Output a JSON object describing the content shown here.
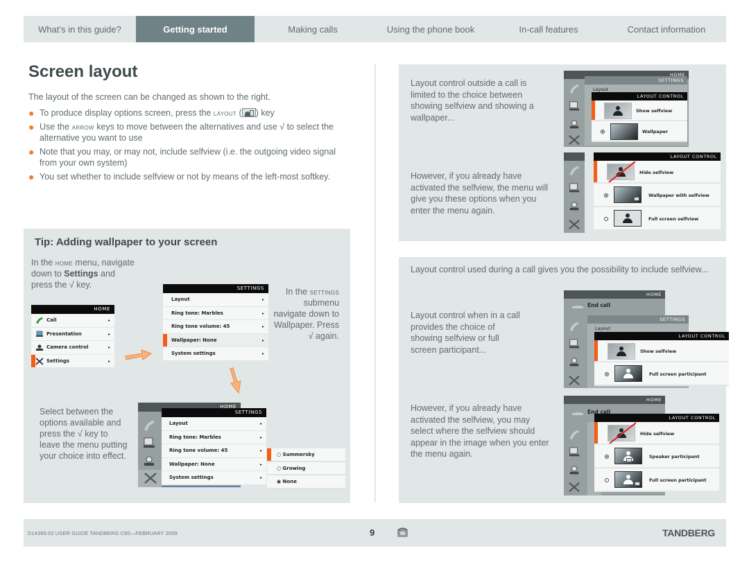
{
  "nav": {
    "tabs": [
      {
        "label": "What’s in this guide?",
        "active": false
      },
      {
        "label": "Getting started",
        "active": true
      },
      {
        "label": "Making calls",
        "active": false
      },
      {
        "label": "Using the phone book",
        "active": false
      },
      {
        "label": "In-call features",
        "active": false
      },
      {
        "label": "Contact information",
        "active": false
      }
    ]
  },
  "page": {
    "title": "Screen layout",
    "intro": "The layout of the screen can be changed as shown to the right.",
    "bullets": {
      "b1_pre": "To produce display options screen, press the ",
      "b1_key": "layout",
      "b1_post": ") key",
      "b2_pre": "Use the ",
      "b2_key": "arrow",
      "b2_post": " keys to move between the alternatives and use √ to select the alternative you want to use",
      "b3": "Note that you may, or may not, include selfview (i.e. the outgoing video signal from your own system)",
      "b4": "You set whether to include selfview or not by means of the left-most softkey."
    },
    "bullet_color": "#f07b2c",
    "key_icon": "layout-key-icon"
  },
  "tip": {
    "title": "Tip: Adding wallpaper to your screen",
    "step1_pre": "In the ",
    "step1_key": "home",
    "step1_mid": " menu, navigate down to ",
    "step1_bold": "Settings",
    "step1_post": " and press the √ key.",
    "step2_pre": "In the ",
    "step2_key": "settings",
    "step2_post": " submenu navigate down to Wallpaper. Press √ again.",
    "step3": "Select between the options available and press the √ key to leave the menu putting your choice into effect.",
    "home_menu": {
      "header": "HOME",
      "items": [
        "Call",
        "Presentation",
        "Camera control",
        "Settings"
      ],
      "selected": "Settings"
    },
    "settings_menu": {
      "header": "SETTINGS",
      "items": [
        "Layout",
        "Ring tone: Marbles",
        "Ring tone volume: 45",
        "Wallpaper: None",
        "System settings"
      ],
      "selected": "Wallpaper: None"
    },
    "wallpaper_menu": {
      "home_header": "HOME",
      "settings_header": "SETTINGS",
      "items": [
        "Layout",
        "Ring tone: Marbles",
        "Ring tone volume: 45",
        "Wallpaper: None",
        "System settings"
      ],
      "options": [
        {
          "label": "Summersky",
          "checked": false
        },
        {
          "label": "Growing",
          "checked": false
        },
        {
          "label": "None",
          "checked": true
        }
      ]
    }
  },
  "right_top": {
    "text1": "Layout control outside a call is limited to the choice between showing selfview and showing a wallpaper...",
    "text2": "However, if you already have activated the selfview, the menu will give you these options when you enter the menu again.",
    "mock1": {
      "home_header": "HOME",
      "settings_header": "SETTINGS",
      "settings_row": "Layout",
      "lc_header": "LAYOUT CONTROL",
      "rows": [
        {
          "label": "Show selfview"
        },
        {
          "label": "Wallpaper",
          "radio": "on"
        }
      ]
    },
    "mock2": {
      "lc_header": "LAYOUT CONTROL",
      "rows": [
        {
          "label": "Hide selfview"
        },
        {
          "label": "Wallpaper with selfview",
          "radio": "on"
        },
        {
          "label": "Full screen selfview",
          "radio": "off"
        }
      ]
    }
  },
  "right_bottom": {
    "text1": "Layout control used during a call gives you the possibility to include selfview...",
    "text2": "Layout control when in a call provides the choice of showing selfview or full screen participant...",
    "text3": "However, if you already have activated the selfview, you may select where the selfview should appear in the image when you enter the menu again.",
    "mock1": {
      "home_header": "HOME",
      "end_call": "End call",
      "settings_header": "SETTINGS",
      "settings_row": "Layout",
      "lc_header": "LAYOUT CONTROL",
      "rows": [
        {
          "label": "Show selfview"
        },
        {
          "label": "Full screen participant",
          "radio": "on"
        }
      ]
    },
    "mock2": {
      "home_header": "HOME",
      "end_call": "End call",
      "lc_header": "LAYOUT CONTROL",
      "rows": [
        {
          "label": "Hide selfview"
        },
        {
          "label": "Speaker participant",
          "radio": "on"
        },
        {
          "label": "Full screen participant",
          "radio": "off"
        }
      ]
    }
  },
  "footer": {
    "doc_id": "D14369.02 USER GUIDE TANDBERG C60—FEBRUARY 2009",
    "page_number": "9",
    "brand": "TANDBERG"
  },
  "colors": {
    "accent_orange": "#f35d14",
    "panel_bg": "#e1e6e7",
    "active_tab": "#6f8285"
  }
}
